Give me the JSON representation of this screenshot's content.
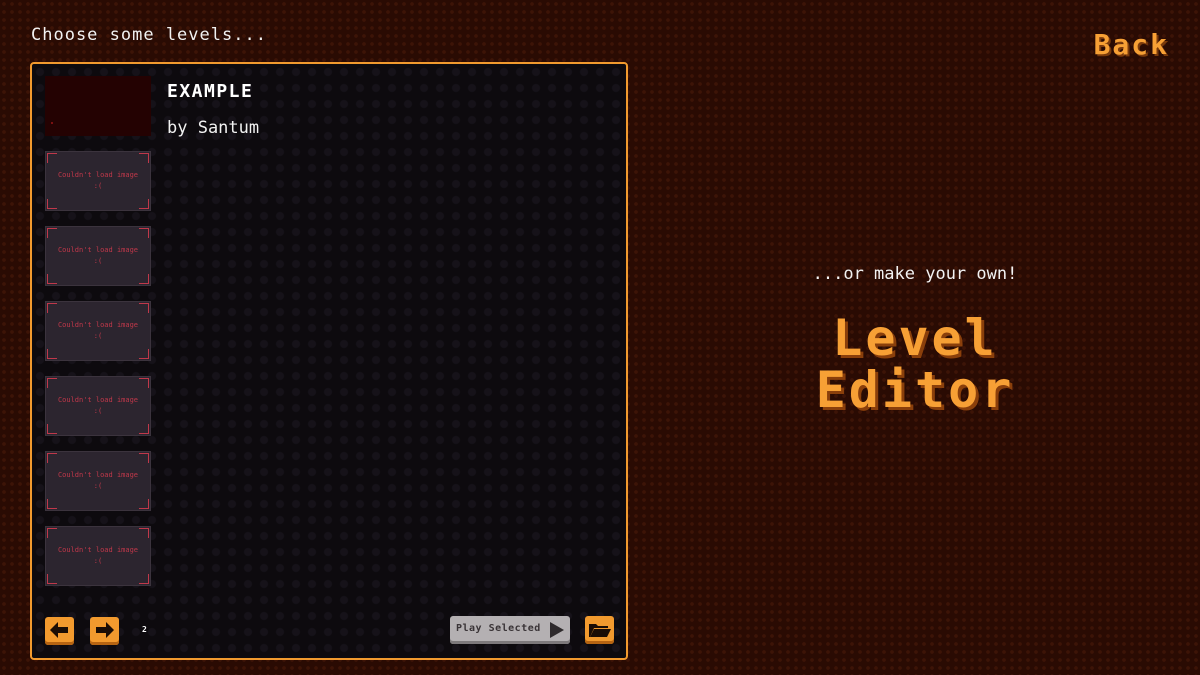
{
  "header": {
    "prompt": "Choose some levels...",
    "back_label": "Back"
  },
  "levels": [
    {
      "title": "EXAMPLE",
      "author": "by Santum",
      "thumbnail": "example-preview"
    },
    {
      "thumbnail": "broken-image"
    },
    {
      "thumbnail": "broken-image"
    },
    {
      "thumbnail": "broken-image"
    },
    {
      "thumbnail": "broken-image"
    },
    {
      "thumbnail": "broken-image"
    },
    {
      "thumbnail": "broken-image"
    }
  ],
  "broken_image": {
    "text": "Couldn't load image",
    "glyph": ":("
  },
  "pagination": {
    "page": "2",
    "prev_icon": "arrow-left-icon",
    "next_icon": "arrow-right-icon"
  },
  "actions": {
    "play_label": "Play Selected",
    "play_icon": "play-triangle-icon",
    "folder_icon": "folder-open-icon"
  },
  "editor": {
    "subtitle": "...or make your own!",
    "title_line1": "Level",
    "title_line2": "Editor"
  },
  "colors": {
    "accent": "#f29a2e",
    "background": "#2a0b03",
    "panel": "#0d0a0e",
    "error": "#c0384a"
  }
}
